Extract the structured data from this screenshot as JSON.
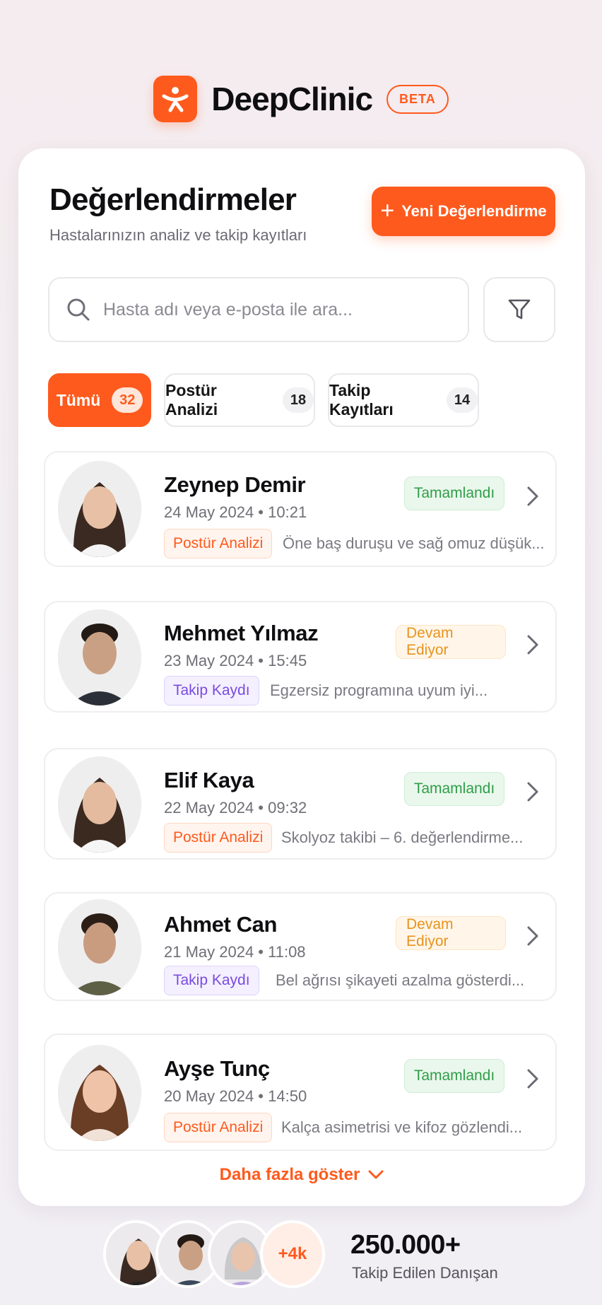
{
  "brand": {
    "name": "DeepClinic",
    "badge": "BETA",
    "accent": "#fe5a1d"
  },
  "header": {
    "title": "Değerlendirmeler",
    "subtitle": "Hastalarınızın analiz ve takip kayıtları",
    "new_button_label": "Yeni Değerlendirme"
  },
  "search": {
    "placeholder": "Hasta adı veya e-posta ile ara...",
    "value": ""
  },
  "tabs": [
    {
      "label": "Tümü",
      "count": "32",
      "active": true
    },
    {
      "label": "Postür Analizi",
      "count": "18",
      "active": false
    },
    {
      "label": "Takip Kayıtları",
      "count": "14",
      "active": false
    }
  ],
  "items": [
    {
      "name": "Zeynep Demir",
      "date": "24 May 2024 • 10:21",
      "tag": "Postür Analizi",
      "tag_type": "posture",
      "note": "Öne baş duruşu ve sağ omuz düşük...",
      "status": "Tamamlandı",
      "status_type": "done"
    },
    {
      "name": "Mehmet Yılmaz",
      "date": "23 May 2024 • 15:45",
      "tag": "Takip Kaydı",
      "tag_type": "followup",
      "note": "Egzersiz programına uyum iyi...",
      "status": "Devam Ediyor",
      "status_type": "progress"
    },
    {
      "name": "Elif Kaya",
      "date": "22 May 2024 • 09:32",
      "tag": "Postür Analizi",
      "tag_type": "posture",
      "note": "Skolyoz takibi – 6. değerlendirme...",
      "status": "Tamamlandı",
      "status_type": "done"
    },
    {
      "name": "Ahmet Can",
      "date": "21 May 2024 • 11:08",
      "tag": "Takip Kaydı",
      "tag_type": "followup",
      "note": "Bel ağrısı şikayeti azalma gösterdi...",
      "status": "Devam Ediyor",
      "status_type": "progress"
    },
    {
      "name": "Ayşe Tunç",
      "date": "20 May 2024 • 14:50",
      "tag": "Postür Analizi",
      "tag_type": "posture",
      "note": "Kalça asimetrisi ve kifoz gözlendi...",
      "status": "Tamamlandı",
      "status_type": "done"
    }
  ],
  "show_more_label": "Daha fazla göster",
  "footer": {
    "extra_count": "+4k",
    "stat_value": "250.000+",
    "stat_label": "Takip Edilen Danışan"
  },
  "status_colors": {
    "done": "#2f9e49",
    "progress": "#e7931f"
  }
}
